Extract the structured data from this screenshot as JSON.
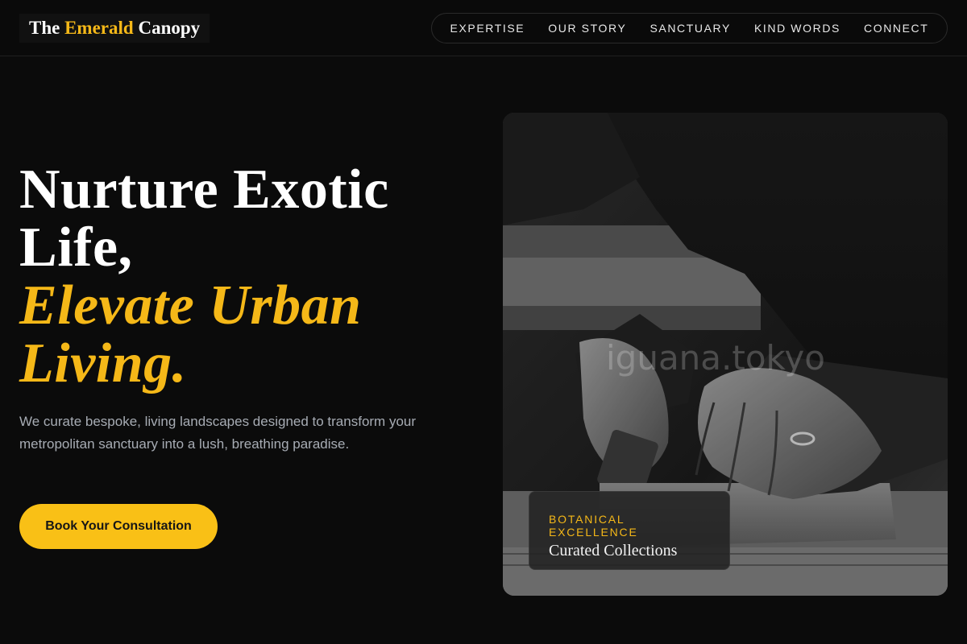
{
  "brand": {
    "prefix": "The ",
    "accent": "Emerald",
    "suffix": " Canopy"
  },
  "nav": {
    "items": [
      "EXPERTISE",
      "OUR STORY",
      "SANCTUARY",
      "KIND WORDS",
      "CONNECT"
    ]
  },
  "hero": {
    "title_line1": "Nurture Exotic",
    "title_line2": "Life,",
    "title_line3": "Elevate Urban",
    "title_line4": "Living.",
    "subtitle": "We curate bespoke, living landscapes designed to transform your metropolitan sanctuary into a lush, breathing paradise.",
    "cta_label": "Book Your Consultation"
  },
  "feature": {
    "watermark": "iguana.tokyo",
    "badge_kicker": "BOTANICAL EXCELLENCE",
    "badge_title": "Curated Collections"
  },
  "colors": {
    "accent": "#f5b818",
    "background": "#0b0b0b",
    "cta": "#f9c016"
  }
}
